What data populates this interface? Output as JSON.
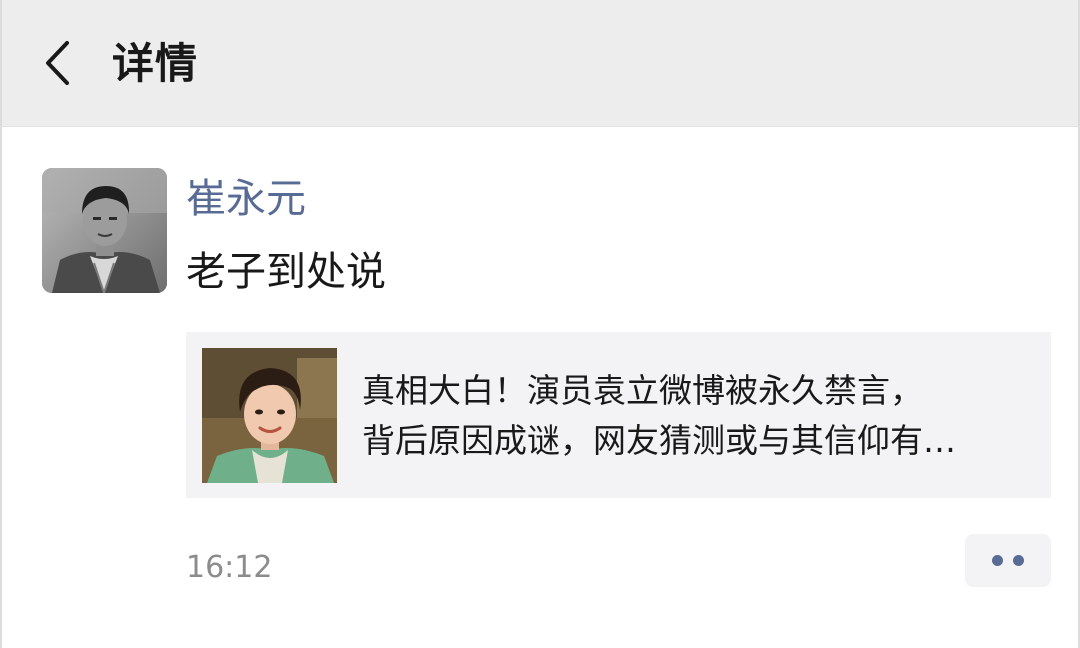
{
  "header": {
    "title": "详情",
    "back_icon": "chevron-left-icon"
  },
  "post": {
    "author": "崔永元",
    "text": "老子到处说",
    "link": {
      "title_line1": "真相大白！演员袁立微博被永久禁言，",
      "title_line2": "背后原因成谜，网友猜测或与其信仰有…"
    },
    "time": "16:12",
    "more_icon": "more-dots-icon"
  },
  "colors": {
    "header_bg": "#ededed",
    "name_link": "#576b95",
    "text": "#191919",
    "card_bg": "#f3f3f5",
    "time": "#8c8c8c"
  }
}
